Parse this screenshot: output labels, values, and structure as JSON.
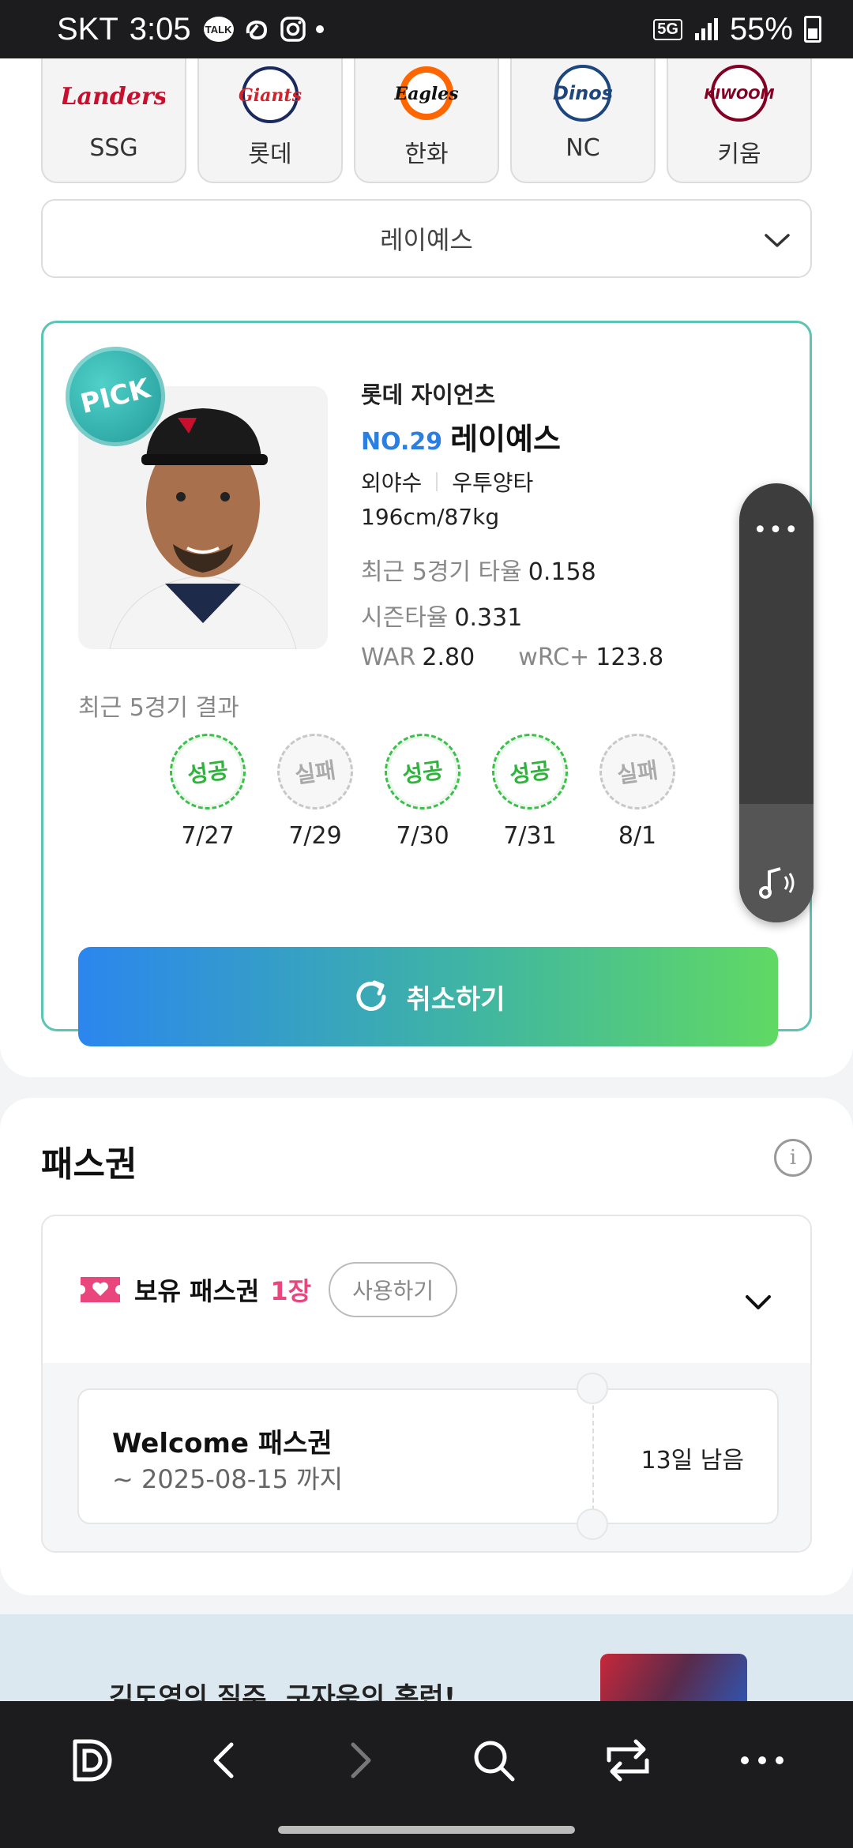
{
  "status_bar": {
    "carrier": "SKT",
    "time": "3:05",
    "talk_badge": "TALK",
    "network": "5G",
    "battery": "55%"
  },
  "teams": [
    {
      "name": "SSG",
      "logo_text": "Landers",
      "logo_color": "#c8102e"
    },
    {
      "name": "롯데",
      "logo_text": "Giants",
      "logo_color": "#d2232a"
    },
    {
      "name": "한화",
      "logo_text": "Eagles",
      "logo_color": "#ff6600"
    },
    {
      "name": "NC",
      "logo_text": "Dinos",
      "logo_color": "#1d467f"
    },
    {
      "name": "키움",
      "logo_text": "KIWOOM",
      "logo_color": "#820024"
    }
  ],
  "player_select": {
    "value": "레이예스"
  },
  "pick_card": {
    "badge": "PICK",
    "team": "롯데 자이언츠",
    "number": "NO.29",
    "name": "레이예스",
    "position": "외야수",
    "bats_throws": "우투양타",
    "body": "196cm/87kg",
    "stats": {
      "recent5_label": "최근 5경기 타율",
      "recent5_value": "0.158",
      "season_label": "시즌타율",
      "season_value": "0.331",
      "war_label": "WAR",
      "war_value": "2.80",
      "wrc_label": "wRC+",
      "wrc_value": "123.8"
    },
    "recent_results_label": "최근 5경기 결과",
    "results": [
      {
        "result": "성공",
        "date": "7/27",
        "status": "success"
      },
      {
        "result": "실패",
        "date": "7/29",
        "status": "fail"
      },
      {
        "result": "성공",
        "date": "7/30",
        "status": "success"
      },
      {
        "result": "성공",
        "date": "7/31",
        "status": "success"
      },
      {
        "result": "실패",
        "date": "8/1",
        "status": "fail"
      }
    ],
    "cancel_label": "취소하기"
  },
  "float_pill": {
    "more": "•••"
  },
  "pass": {
    "title": "패스권",
    "owned_label": "보유 패스권",
    "owned_count": "1장",
    "use_label": "사용하기",
    "ticket": {
      "name": "Welcome 패스권",
      "expiry": "~ 2025-08-15 까지",
      "remaining": "13일 남음"
    }
  },
  "banner": {
    "text": "김도영의 질주, 구자욱의 홈런!"
  },
  "colors": {
    "accent_blue": "#2b86ee",
    "accent_green": "#60d964",
    "pass_pink": "#e8467c",
    "success_green": "#2fb33c"
  }
}
